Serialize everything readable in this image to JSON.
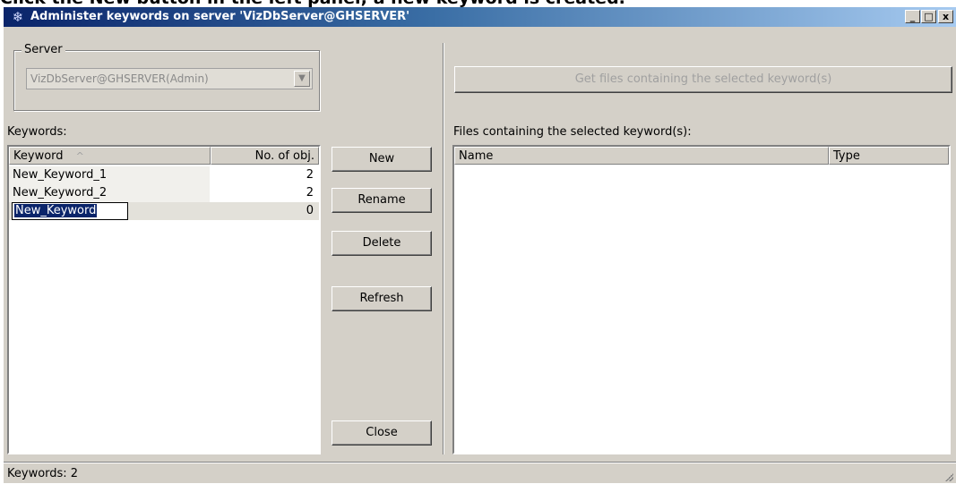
{
  "top_caption_cut": "Click the New button in the left panel; a new keyword is created.",
  "window": {
    "title": "Administer keywords on server 'VizDbServer@GHSERVER'",
    "icon": "snowflake-icon",
    "caption_buttons": {
      "minimize": "_",
      "maximize": "□",
      "close": "x"
    }
  },
  "server": {
    "group_label": "Server",
    "selected": "VizDbServer@GHSERVER(Admin)"
  },
  "keywords": {
    "label": "Keywords:",
    "columns": [
      "Keyword",
      "No. of obj."
    ],
    "sort_indicator": "^",
    "rows": [
      {
        "keyword": "New_Keyword_1",
        "count": "2"
      },
      {
        "keyword": "New_Keyword_2",
        "count": "2"
      },
      {
        "keyword": "New_Keyword",
        "count": "0"
      }
    ]
  },
  "buttons": {
    "new": "New",
    "rename": "Rename",
    "delete": "Delete",
    "refresh": "Refresh",
    "close": "Close",
    "get_files": "Get files containing the selected keyword(s)"
  },
  "files": {
    "label": "Files containing the selected keyword(s):",
    "columns": [
      "Name",
      "Type"
    ]
  },
  "status": {
    "text": "Keywords: 2"
  }
}
